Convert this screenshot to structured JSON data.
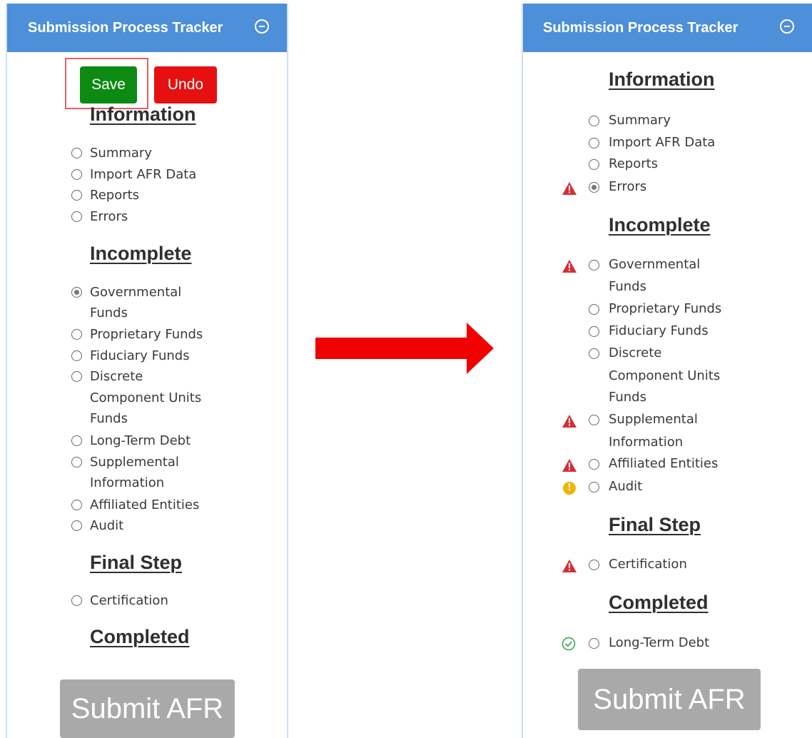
{
  "left_panel": {
    "title": "Submission Process Tracker",
    "save_label": "Save",
    "undo_label": "Undo",
    "sections": {
      "information": {
        "heading": "Information",
        "items": [
          "Summary",
          "Import AFR Data",
          "Reports",
          "Errors"
        ]
      },
      "incomplete": {
        "heading": "Incomplete",
        "items": [
          "Governmental",
          "Funds",
          "Proprietary Funds",
          "Fiduciary Funds",
          "Discrete",
          "Component Units",
          "Funds",
          "Long-Term Debt",
          "Supplemental",
          "Information",
          "Affiliated Entities",
          "Audit"
        ]
      },
      "final_step": {
        "heading": "Final Step",
        "items": [
          "Certification"
        ]
      },
      "completed": {
        "heading": "Completed"
      }
    },
    "selected_item": "Governmental Funds",
    "submit_label": "Submit AFR"
  },
  "right_panel": {
    "title": "Submission Process Tracker",
    "sections": {
      "information": {
        "heading": "Information",
        "items": [
          "Summary",
          "Import AFR Data",
          "Reports",
          "Errors"
        ]
      },
      "incomplete": {
        "heading": "Incomplete",
        "items": [
          "Governmental",
          "Funds",
          "Proprietary Funds",
          "Fiduciary Funds",
          "Discrete",
          "Component Units",
          "Funds",
          "Supplemental",
          "Information",
          "Affiliated Entities",
          "Audit"
        ]
      },
      "final_step": {
        "heading": "Final Step",
        "items": [
          "Certification"
        ]
      },
      "completed": {
        "heading": "Completed",
        "items": [
          "Long-Term Debt"
        ]
      }
    },
    "selected_item": "Errors",
    "submit_label": "Submit AFR"
  },
  "status_icons": {
    "Errors": "warning-icon",
    "Governmental Funds": "warning-icon",
    "Supplemental Information": "warning-icon",
    "Affiliated Entities": "warning-icon",
    "Audit": "info-icon",
    "Certification": "warning-icon",
    "Long-Term Debt": "check-circle-icon"
  },
  "colors": {
    "header": "#4d8fd8",
    "save": "#0c8a12",
    "undo": "#e61010",
    "submit": "#a9a9a9",
    "arrow": "#f00000",
    "warning": "#d62e36",
    "info": "#f2b400",
    "check": "#2e9e45"
  }
}
